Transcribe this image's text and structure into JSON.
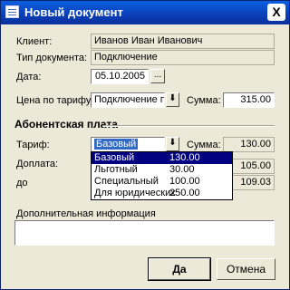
{
  "window": {
    "title": "Новый документ",
    "close_glyph": "X"
  },
  "form": {
    "client": {
      "label": "Клиент:",
      "value": "Иванов Иван Иванович"
    },
    "doc_type": {
      "label": "Тип документа:",
      "value": "Подключение"
    },
    "date": {
      "label": "Дата:",
      "value": "05.10.2005",
      "button_glyph": "..."
    },
    "tariff_price": {
      "label": "Цена по тарифу:",
      "value": "Подключение пе",
      "arrow_glyph": "⬇"
    },
    "sum1": {
      "label": "Сумма:",
      "value": "315.00"
    }
  },
  "subscription": {
    "heading": "Абонентская плата",
    "tariff": {
      "label": "Тариф:",
      "value": "Базовый",
      "arrow_glyph": "⬇"
    },
    "sum2": {
      "label": "Сумма:",
      "value": "130.00"
    },
    "surcharge": {
      "label": "Доплата:",
      "value": "105.00"
    },
    "until": {
      "label": "до",
      "value": "109.03"
    },
    "options": [
      {
        "name": "Базовый",
        "price": "130.00",
        "selected": true
      },
      {
        "name": "Льготный",
        "price": "30.00",
        "selected": false
      },
      {
        "name": "Специальный",
        "price": "100.00",
        "selected": false
      },
      {
        "name": "Для юридических",
        "price": "250.00",
        "selected": false
      }
    ]
  },
  "extra_info": {
    "label": "Дополнительная информация",
    "value": ""
  },
  "buttons": {
    "ok": "Да",
    "cancel": "Отмена"
  }
}
